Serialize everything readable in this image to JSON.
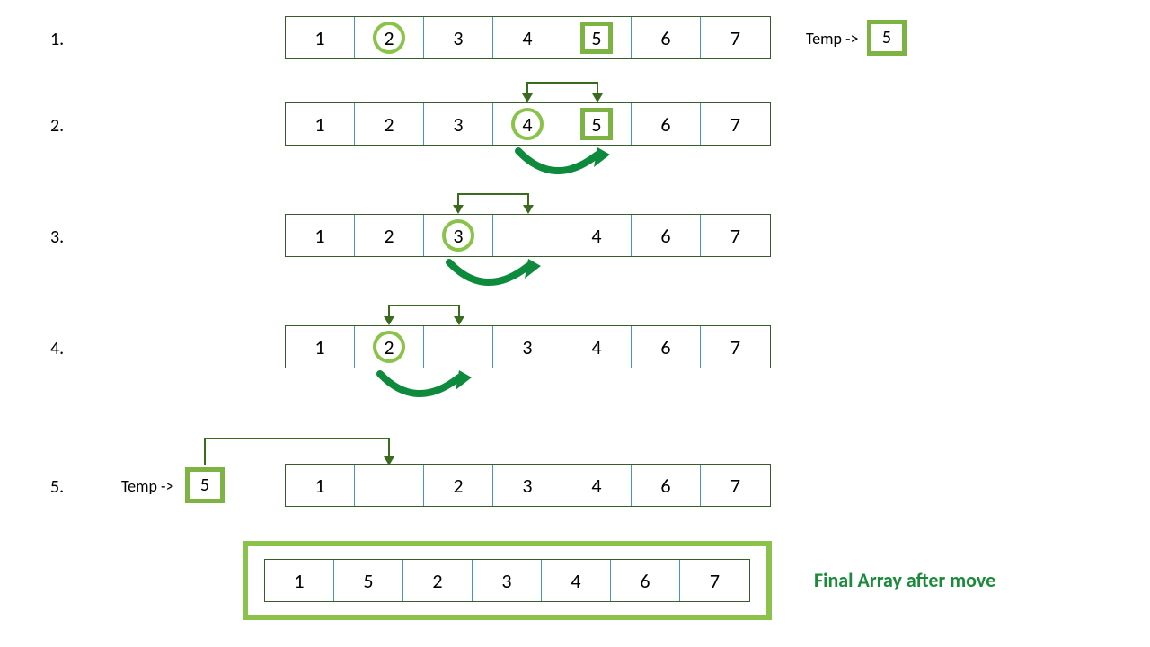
{
  "steps": [
    {
      "label": "1.",
      "cells": [
        "1",
        "2",
        "3",
        "4",
        "5",
        "6",
        "7"
      ],
      "circle_idx": 1,
      "square_idx": 4
    },
    {
      "label": "2.",
      "cells": [
        "1",
        "2",
        "3",
        "4",
        "5",
        "6",
        "7"
      ],
      "circle_idx": 3,
      "square_idx": 4
    },
    {
      "label": "3.",
      "cells": [
        "1",
        "2",
        "3",
        "",
        "4",
        "6",
        "7"
      ],
      "circle_idx": 2,
      "square_idx": null
    },
    {
      "label": "4.",
      "cells": [
        "1",
        "2",
        "",
        "3",
        "4",
        "6",
        "7"
      ],
      "circle_idx": 1,
      "square_idx": null
    },
    {
      "label": "5.",
      "cells": [
        "1",
        "",
        "2",
        "3",
        "4",
        "6",
        "7"
      ],
      "circle_idx": null,
      "square_idx": null
    }
  ],
  "temp": {
    "label": "Temp ->",
    "value": "5"
  },
  "final": {
    "cells": [
      "1",
      "5",
      "2",
      "3",
      "4",
      "6",
      "7"
    ],
    "label": "Final Array after move"
  },
  "colors": {
    "accent": "#7cb342",
    "arrow_dark": "#3a6b1e",
    "arrow_curve": "#0e8a3d"
  }
}
